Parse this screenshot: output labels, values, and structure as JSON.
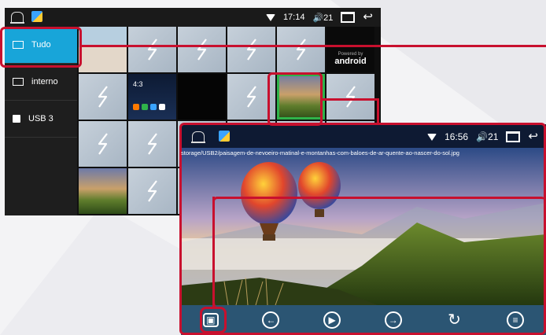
{
  "gallery": {
    "status": {
      "time": "17:14",
      "volume": "21"
    },
    "sidebar": {
      "items": [
        {
          "label": "Tudo",
          "active": true
        },
        {
          "label": "interno",
          "active": false
        },
        {
          "label": "USB 3",
          "active": false
        }
      ]
    },
    "tiles": [
      "photo-people",
      "placeholder",
      "placeholder",
      "placeholder",
      "placeholder",
      "android",
      "placeholder",
      "ui-screenshot",
      "black",
      "placeholder",
      "balloon-selected",
      "placeholder",
      "placeholder",
      "placeholder",
      "placeholder",
      "placeholder",
      "placeholder",
      "placeholder",
      "balloon",
      "placeholder",
      "placeholder",
      "placeholder",
      "placeholder",
      "placeholder"
    ],
    "android_tile": {
      "powered_by": "Powered by",
      "brand": "android"
    },
    "ui_tile": {
      "digits": "4:3"
    }
  },
  "viewer": {
    "status": {
      "time": "16:56",
      "volume": "21"
    },
    "file_path": "storage/USB2/paisagem-de-nevoeiro-matinal-e-montanhas-com-baloes-de-ar-quente-ao-nascer-do-sol.jpg",
    "toolbar": {
      "buttons": [
        "gallery-icon",
        "previous-icon",
        "play-icon",
        "next-icon",
        "rotate-icon",
        "menu-icon"
      ]
    }
  },
  "colors": {
    "accent": "#18a5d9",
    "callout": "#c8102e",
    "selected": "#2fb34a",
    "toolbar": "#2b5573"
  }
}
